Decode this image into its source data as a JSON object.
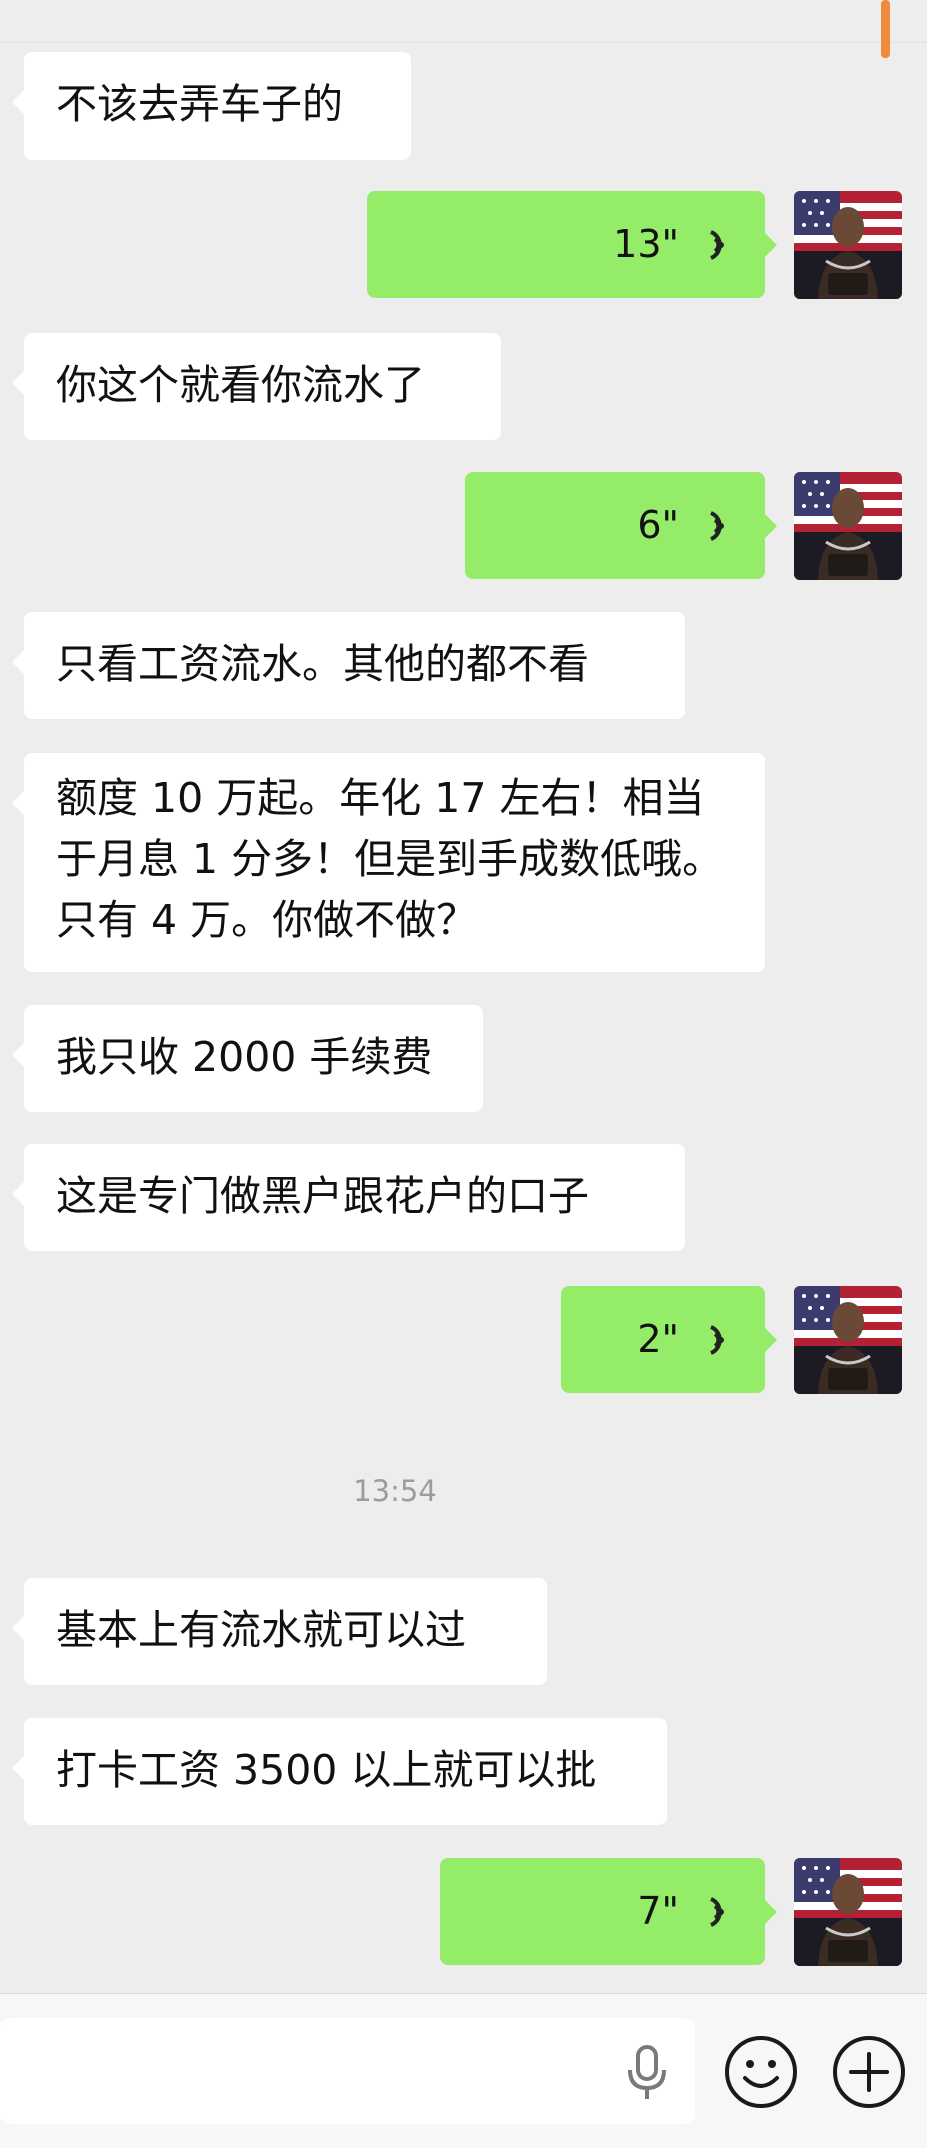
{
  "conversation": {
    "timestamp": "13:54",
    "messages": [
      {
        "side": "in",
        "text": "不该去弄车子的"
      },
      {
        "side": "out",
        "type": "voice",
        "duration": "13\""
      },
      {
        "side": "in",
        "text": "你这个就看你流水了"
      },
      {
        "side": "out",
        "type": "voice",
        "duration": "6\""
      },
      {
        "side": "in",
        "text": "只看工资流水。其他的都不看"
      },
      {
        "side": "in",
        "text": "额度 10 万起。年化 17 左右！相当于月息 1 分多！但是到手成数低哦。只有 4 万。你做不做？"
      },
      {
        "side": "in",
        "text": "我只收 2000 手续费"
      },
      {
        "side": "in",
        "text": "这是专门做黑户跟花户的口子"
      },
      {
        "side": "out",
        "type": "voice",
        "duration": "2\""
      },
      {
        "side": "in",
        "text": "基本上有流水就可以过"
      },
      {
        "side": "in",
        "text": "打卡工资 3500 以上就可以批"
      },
      {
        "side": "out",
        "type": "voice",
        "duration": "7\""
      }
    ]
  },
  "input_bar": {
    "icons": [
      "microphone-icon",
      "emoji-icon",
      "plus-icon"
    ]
  },
  "colors": {
    "background": "#ededed",
    "outgoing_bubble": "#95ec69",
    "incoming_bubble": "#ffffff",
    "scroll_accent": "#f08a3c"
  }
}
